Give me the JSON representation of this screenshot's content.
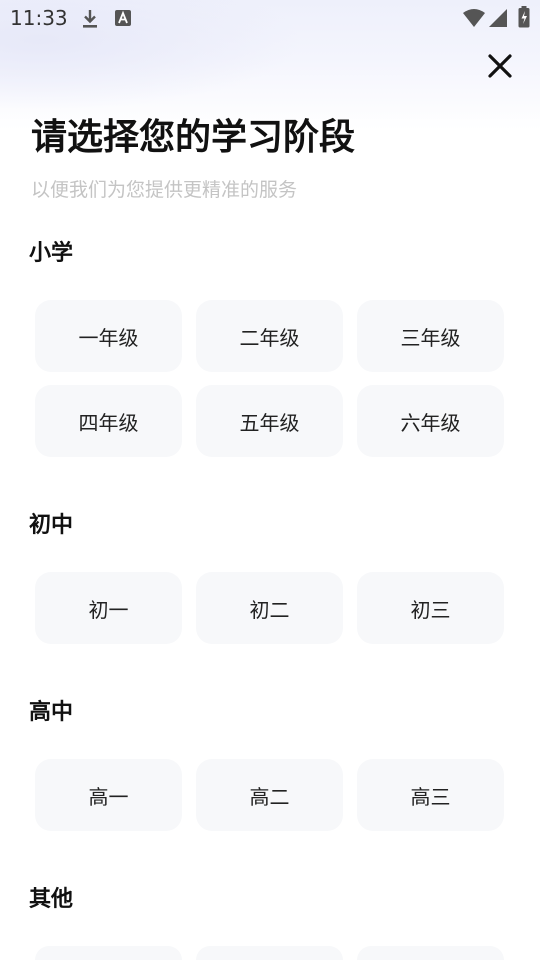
{
  "status_bar": {
    "time": "11:33",
    "left_icons": [
      "download-icon",
      "font-app-icon"
    ],
    "right_icons": [
      "wifi-icon",
      "signal-icon",
      "battery-charging-icon"
    ]
  },
  "header": {
    "title": "请选择您的学习阶段",
    "subtitle": "以便我们为您提供更精准的服务",
    "close_icon": "close-icon"
  },
  "sections": [
    {
      "title": "小学",
      "grades": [
        "一年级",
        "二年级",
        "三年级",
        "四年级",
        "五年级",
        "六年级"
      ]
    },
    {
      "title": "初中",
      "grades": [
        "初一",
        "初二",
        "初三"
      ]
    },
    {
      "title": "高中",
      "grades": [
        "高一",
        "高二",
        "高三"
      ]
    },
    {
      "title": "其他"
    }
  ],
  "colors": {
    "button_bg": "#f7f8fa",
    "title_text": "#111111",
    "subtitle_text": "#c4c4c4"
  }
}
